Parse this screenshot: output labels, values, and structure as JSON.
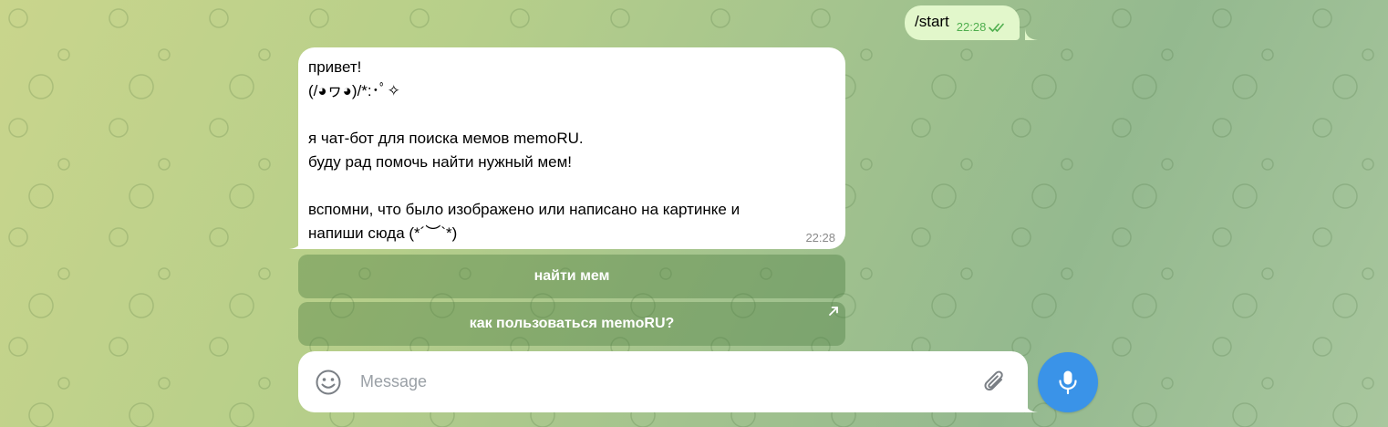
{
  "colors": {
    "outgoing_bubble": "#e2f7cb",
    "incoming_bubble": "#ffffff",
    "accent": "#3a93e8",
    "read_check": "#4fae4e"
  },
  "chat": {
    "messages": [
      {
        "direction": "outgoing",
        "text": "/start",
        "time": "22:28",
        "status_icon": "double-check-icon"
      },
      {
        "direction": "incoming",
        "text": "привет!\n(/◕ヮ◕)/*:･ﾟ✧\n\nя чат-бот для поиска мемов memoRU.\nбуду рад помочь найти нужный мем!\n\nвспомни, что было изображено или написано на картинке и\nнапиши сюда (*´︶`*)",
        "time": "22:28"
      }
    ],
    "inline_keyboard": [
      {
        "label": "найти мем"
      },
      {
        "label": "как пользоваться memoRU?",
        "icon": "external-link-arrow-icon"
      }
    ]
  },
  "composer": {
    "placeholder": "Message",
    "value": "",
    "left_icon": "emoji-icon",
    "attach_icon": "paperclip-icon",
    "send_icon": "microphone-icon"
  }
}
